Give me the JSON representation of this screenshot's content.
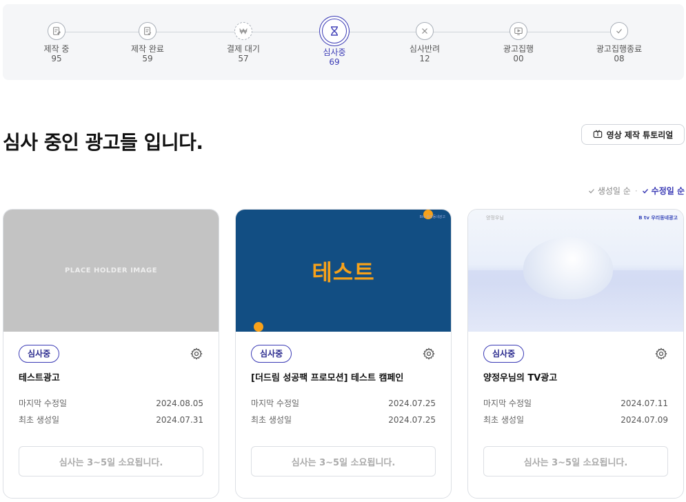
{
  "stepper": {
    "steps": [
      {
        "label": "제작 중",
        "count": "95",
        "icon": "edit-doc-icon"
      },
      {
        "label": "제작 완료",
        "count": "59",
        "icon": "doc-check-icon"
      },
      {
        "label": "결제 대기",
        "count": "57",
        "icon": "won-icon"
      },
      {
        "label": "심사중",
        "count": "69",
        "icon": "hourglass-icon"
      },
      {
        "label": "심사반려",
        "count": "12",
        "icon": "x-circle-icon"
      },
      {
        "label": "광고집행",
        "count": "00",
        "icon": "tv-play-icon"
      },
      {
        "label": "광고집행종료",
        "count": "08",
        "icon": "check-circle-icon"
      }
    ]
  },
  "heading": {
    "title": "심사 중인 광고들 입니다."
  },
  "tutorial": {
    "label": "영상 제작 튜토리얼"
  },
  "sort": {
    "options": [
      "생성일 순",
      "수정일 순"
    ],
    "separator": "·",
    "active": "수정일 순"
  },
  "meta_labels": {
    "modified": "마지막 수정일",
    "created": "최초 생성일"
  },
  "cards": [
    {
      "status": "심사중",
      "title": "테스트광고",
      "modified": "2024.08.05",
      "created": "2024.07.31",
      "notice": "심사는 3~5일 소요됩니다.",
      "thumb_text": "PLACE HOLDER IMAGE"
    },
    {
      "status": "심사중",
      "title": "[더드림 성공팩 프로모션] 테스트 캠페인",
      "modified": "2024.07.25",
      "created": "2024.07.25",
      "notice": "심사는 3~5일 소요됩니다.",
      "thumb_text": "테스트",
      "thumb_brand": "Btv 우리동네광고"
    },
    {
      "status": "심사중",
      "title": "양정우님의 TV광고",
      "modified": "2024.07.11",
      "created": "2024.07.09",
      "notice": "심사는 3~5일 소요됩니다.",
      "thumb_brand": "B tv 우리동네광고",
      "thumb_brand_left": "양정우님"
    }
  ],
  "colors": {
    "accent": "#3a3ab5",
    "thumb_blue": "#124e83",
    "thumb_orange": "#f7a11a"
  }
}
